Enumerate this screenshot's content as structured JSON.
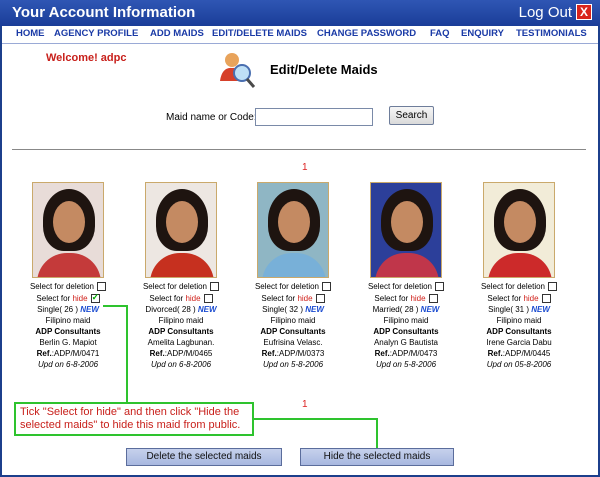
{
  "header": {
    "title": "Your Account Information",
    "logout_label": "Log Out",
    "close_glyph": "X"
  },
  "nav": {
    "items": [
      "HOME",
      "AGENCY PROFILE",
      "ADD MAIDS",
      "EDIT/DELETE MAIDS",
      "CHANGE PASSWORD",
      "FAQ",
      "ENQUIRY",
      "TESTIMONIALS"
    ]
  },
  "welcome": "Welcome! adpc",
  "page": {
    "title": "Edit/Delete Maids",
    "icon": "person-search-icon"
  },
  "search": {
    "label": "Maid name or Code:",
    "value": "",
    "button": "Search"
  },
  "pagination": {
    "top": "1",
    "bottom": "1"
  },
  "maids": [
    {
      "select_delete": "Select for deletion",
      "select_hide_prefix": "Select for",
      "select_hide_word": "hide",
      "hide_checked": true,
      "status": "Single( 26 )",
      "new": "NEW",
      "nationality": "Filipino maid",
      "agency": "ADP Consultants",
      "name": "Berlin G. Mapiot",
      "ref_label": "Ref.",
      "ref": ":ADP/M/0471",
      "updated": "Upd on 6-8-2006",
      "bg": "#e8dcd8",
      "shirt": "#c43a3a"
    },
    {
      "select_delete": "Select for deletion",
      "select_hide_prefix": "Select for",
      "select_hide_word": "hide",
      "hide_checked": false,
      "status": "Divorced( 28 )",
      "new": "NEW",
      "nationality": "Filipino maid",
      "agency": "ADP Consultants",
      "name": "Amelita Lagbunan.",
      "ref_label": "Ref.",
      "ref": ":ADP/M/0465",
      "updated": "Upd on 6-8-2006",
      "bg": "#ede7e2",
      "shirt": "#c6301f"
    },
    {
      "select_delete": "Select for deletion",
      "select_hide_prefix": "Select for",
      "select_hide_word": "hide",
      "hide_checked": false,
      "status": "Single( 32 )",
      "new": "NEW",
      "nationality": "Filipino maid",
      "agency": "ADP Consultants",
      "name": "Eufrisina Velasc.",
      "ref_label": "Ref.",
      "ref": ":ADP/M/0373",
      "updated": "Upd on 5-8-2006",
      "bg": "#8fb6c4",
      "shirt": "#78b0d8"
    },
    {
      "select_delete": "Select for deletion",
      "select_hide_prefix": "Select for",
      "select_hide_word": "hide",
      "hide_checked": false,
      "status": "Married( 28 )",
      "new": "NEW",
      "nationality": "Filipino maid",
      "agency": "ADP Consultants",
      "name": "Analyn G Bautista",
      "ref_label": "Ref.",
      "ref": ":ADP/M/0473",
      "updated": "Upd on 5-8-2006",
      "bg": "#2c3f9a",
      "shirt": "#c0364a"
    },
    {
      "select_delete": "Select for deletion",
      "select_hide_prefix": "Select for",
      "select_hide_word": "hide",
      "hide_checked": false,
      "status": "Single( 31 )",
      "new": "NEW",
      "nationality": "Filipino maid",
      "agency": "ADP Consultants",
      "name": "Irene Garcia Dabu",
      "ref_label": "Ref.",
      "ref": ":ADP/M/0445",
      "updated": "Upd on 05-8-2006",
      "bg": "#f2ecd8",
      "shirt": "#cc2a2a"
    }
  ],
  "tip": "Tick \"Select for hide\" and then click \"Hide the selected maids\" to hide this maid from public.",
  "buttons": {
    "delete": "Delete the selected maids",
    "hide": "Hide the selected maids"
  },
  "colors": {
    "accent": "#1a3d98",
    "highlight": "#2ec32e",
    "alert": "#c8201b"
  }
}
